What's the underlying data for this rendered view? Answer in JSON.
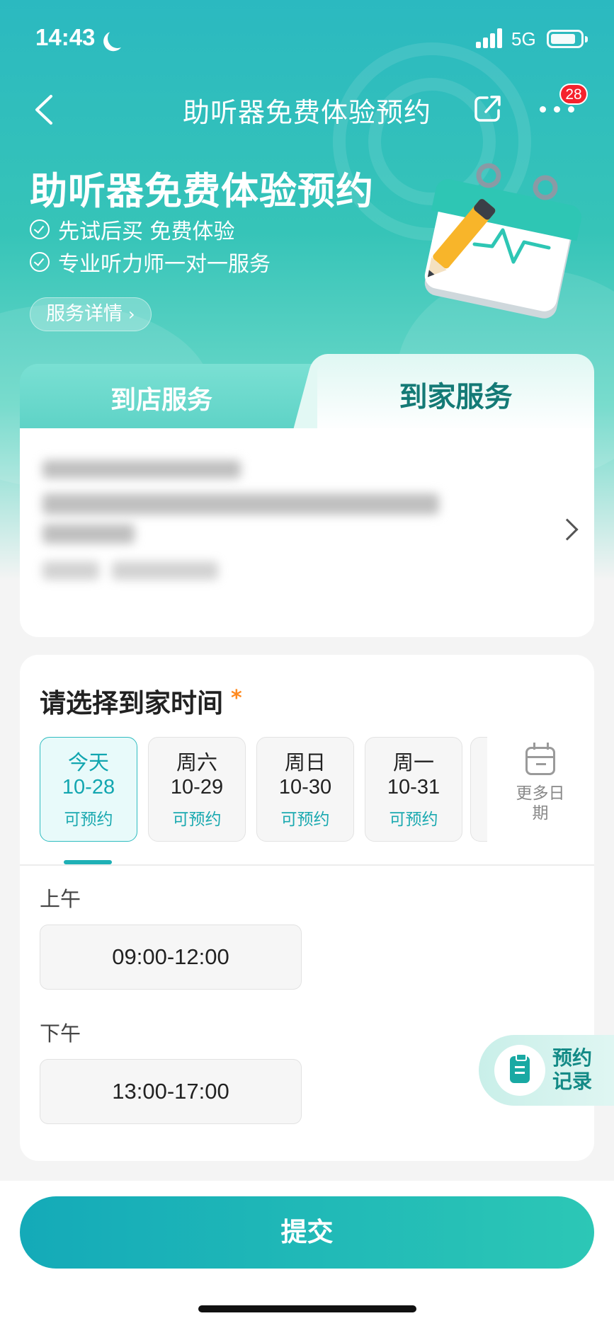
{
  "status_bar": {
    "time": "14:43",
    "network": "5G"
  },
  "nav": {
    "title": "助听器免费体验预约",
    "notification_badge": "28"
  },
  "banner": {
    "title": "助听器免费体验预约",
    "features": [
      "先试后买 免费体验",
      "专业听力师一对一服务"
    ],
    "detail_button": "服务详情"
  },
  "tabs": {
    "store_service": "到店服务",
    "home_service": "到家服务",
    "selected": "到家服务"
  },
  "time_section": {
    "title": "请选择到家时间",
    "required_mark": "*",
    "dates": [
      {
        "day": "今天",
        "date": "10-28",
        "status": "可预约",
        "selected": true
      },
      {
        "day": "周六",
        "date": "10-29",
        "status": "可预约",
        "selected": false
      },
      {
        "day": "周日",
        "date": "10-30",
        "status": "可预约",
        "selected": false
      },
      {
        "day": "周一",
        "date": "10-31",
        "status": "可预约",
        "selected": false
      }
    ],
    "more_dates_label": "更多日期",
    "periods": [
      {
        "label": "上午",
        "slot": "09:00-12:00"
      },
      {
        "label": "下午",
        "slot": "13:00-17:00"
      }
    ]
  },
  "float_button": {
    "label": "预约记录"
  },
  "submit": {
    "label": "提交"
  },
  "colors": {
    "accent": "#1fb0b6",
    "accent_dark": "#147a76",
    "required": "#ff8a1f",
    "badge": "#f5222d"
  }
}
